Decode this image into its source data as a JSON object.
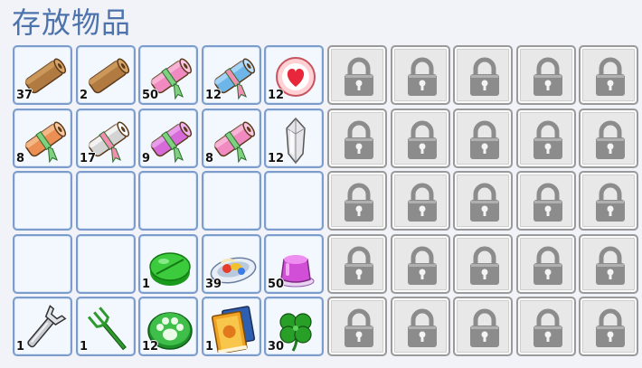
{
  "title": "存放物品",
  "colors": {
    "title": "#4d73ad",
    "slot_border": "#7c9ccc",
    "slot_bg": "#f3f8ff",
    "locked_bg": "#e8e8e8",
    "lock_icon": "#8c8c8c"
  },
  "rows": [
    [
      {
        "icon": "brown-scroll-icon",
        "count": "37"
      },
      {
        "icon": "brown-scroll-icon",
        "count": "2"
      },
      {
        "icon": "pink-ribbon-scroll-icon",
        "count": "50"
      },
      {
        "icon": "blue-ribbon-scroll-icon",
        "count": "12"
      },
      {
        "icon": "heart-badge-icon",
        "count": "12"
      },
      {
        "locked": true
      },
      {
        "locked": true
      },
      {
        "locked": true
      },
      {
        "locked": true
      },
      {
        "locked": true
      }
    ],
    [
      {
        "icon": "orange-ribbon-scroll-icon",
        "count": "8"
      },
      {
        "icon": "white-ribbon-scroll-icon",
        "count": "17"
      },
      {
        "icon": "magenta-ribbon-scroll-icon",
        "count": "9"
      },
      {
        "icon": "pink-ribbon-scroll-icon",
        "count": "8"
      },
      {
        "icon": "silver-crystal-icon",
        "count": "12"
      },
      {
        "locked": true
      },
      {
        "locked": true
      },
      {
        "locked": true
      },
      {
        "locked": true
      },
      {
        "locked": true
      }
    ],
    [
      {
        "empty": true
      },
      {
        "empty": true
      },
      {
        "empty": true
      },
      {
        "empty": true
      },
      {
        "empty": true
      },
      {
        "locked": true
      },
      {
        "locked": true
      },
      {
        "locked": true
      },
      {
        "locked": true
      },
      {
        "locked": true
      }
    ],
    [
      {
        "empty": true
      },
      {
        "empty": true
      },
      {
        "icon": "green-pill-icon",
        "count": "1"
      },
      {
        "icon": "food-plate-icon",
        "count": "39"
      },
      {
        "icon": "purple-jelly-icon",
        "count": "50"
      },
      {
        "locked": true
      },
      {
        "locked": true
      },
      {
        "locked": true
      },
      {
        "locked": true
      },
      {
        "locked": true
      }
    ],
    [
      {
        "icon": "wrench-icon",
        "count": "1"
      },
      {
        "icon": "green-fork-icon",
        "count": "1"
      },
      {
        "icon": "paw-badge-icon",
        "count": "12"
      },
      {
        "icon": "books-icon",
        "count": "1"
      },
      {
        "icon": "four-leaf-clover-icon",
        "count": "30"
      },
      {
        "locked": true
      },
      {
        "locked": true
      },
      {
        "locked": true
      },
      {
        "locked": true
      },
      {
        "locked": true
      }
    ]
  ]
}
